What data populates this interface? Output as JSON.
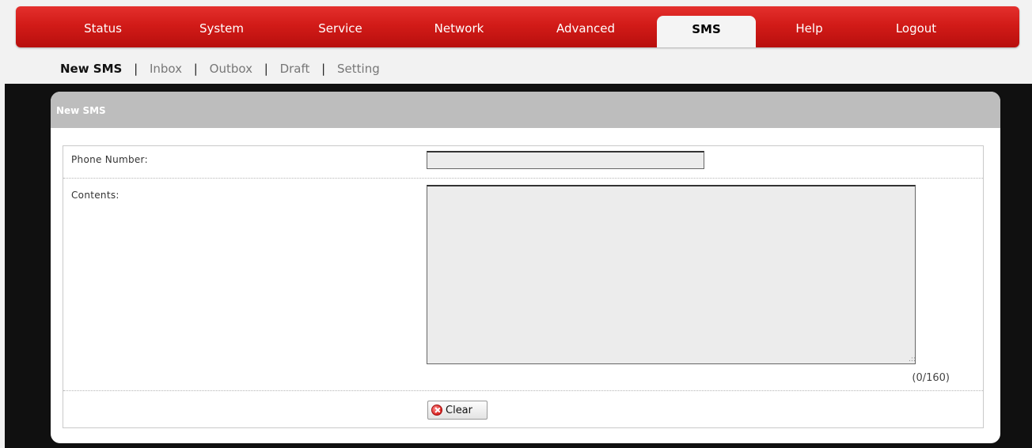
{
  "nav": {
    "tabs": [
      {
        "label": "Status"
      },
      {
        "label": "System"
      },
      {
        "label": "Service"
      },
      {
        "label": "Network"
      },
      {
        "label": "Advanced"
      },
      {
        "label": "SMS"
      },
      {
        "label": "Help"
      },
      {
        "label": "Logout"
      }
    ],
    "active": "SMS"
  },
  "submenu": {
    "items": [
      {
        "label": "New SMS"
      },
      {
        "label": "Inbox"
      },
      {
        "label": "Outbox"
      },
      {
        "label": "Draft"
      },
      {
        "label": "Setting"
      }
    ],
    "separator": "|",
    "active": "New SMS"
  },
  "panel": {
    "title": "New SMS",
    "phone_label": "Phone Number:",
    "phone_value": "",
    "contents_label": "Contents:",
    "contents_value": "",
    "counter": "(0/160)",
    "clear_label": "Clear"
  },
  "colors": {
    "nav_red": "#d21b18",
    "panel_header": "#bdbdbd",
    "background_dark": "#101010"
  }
}
